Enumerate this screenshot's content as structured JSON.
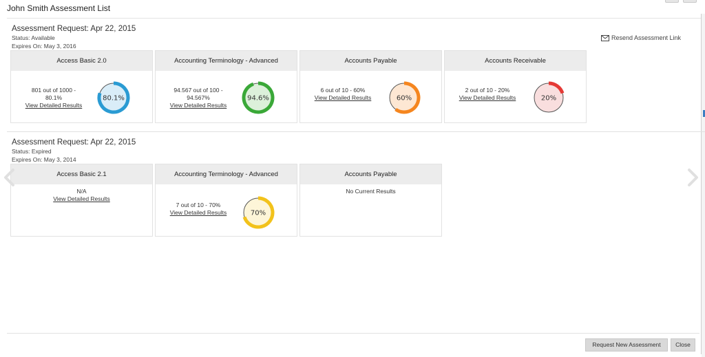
{
  "window": {
    "title": "John Smith Assessment List"
  },
  "resend_link": "Resend Assessment Link",
  "requests": [
    {
      "title": "Assessment Request: Apr 22, 2015",
      "status": "Status: Available",
      "expires": "Expires On: May 3, 2016",
      "cards": [
        {
          "name": "Access Basic 2.0",
          "summary_1": "801 out of 1000 -",
          "summary_2": "80.1%",
          "link": "View Detailed Results",
          "percent": 80.1,
          "gauge_label": "80.1%",
          "color": "#2a9bd3",
          "fill": "#d9edf8"
        },
        {
          "name": "Accounting Terminology - Advanced",
          "summary_1": "94.567 out of 100 -",
          "summary_2": "94.567%",
          "link": "View Detailed Results",
          "percent": 94.6,
          "gauge_label": "94.6%",
          "color": "#3aa838",
          "fill": "#dcf0da"
        },
        {
          "name": "Accounts Payable",
          "summary_1": "6 out of 10 - 60%",
          "link": "View Detailed Results",
          "percent": 60,
          "gauge_label": "60%",
          "color": "#f5861f",
          "fill": "#fde7d3"
        },
        {
          "name": "Accounts Receivable",
          "summary_1": "2 out of 10 - 20%",
          "link": "View Detailed Results",
          "percent": 20,
          "gauge_label": "20%",
          "color": "#e53935",
          "fill": "#f9dede"
        }
      ]
    },
    {
      "title": "Assessment Request: Apr 22, 2015",
      "status": "Status: Expired",
      "expires": "Expires On: May 3, 2014",
      "cards": [
        {
          "name": "Access Basic 2.1",
          "summary_1": "N/A",
          "link": "View Detailed Results"
        },
        {
          "name": "Accounting Terminology - Advanced",
          "summary_1": "7 out of 10 - 70%",
          "link": "View Detailed Results",
          "percent": 70,
          "gauge_label": "70%",
          "color": "#f2c21b",
          "fill": "#fdf5d8"
        },
        {
          "name": "Accounts Payable",
          "summary_1": "No Current Results"
        }
      ]
    }
  ],
  "footer": {
    "request_new": "Request New Assessment",
    "close": "Close"
  },
  "icons": {
    "resend": "envelope-icon",
    "prev": "chevron-left-icon",
    "next": "chevron-right-icon"
  }
}
